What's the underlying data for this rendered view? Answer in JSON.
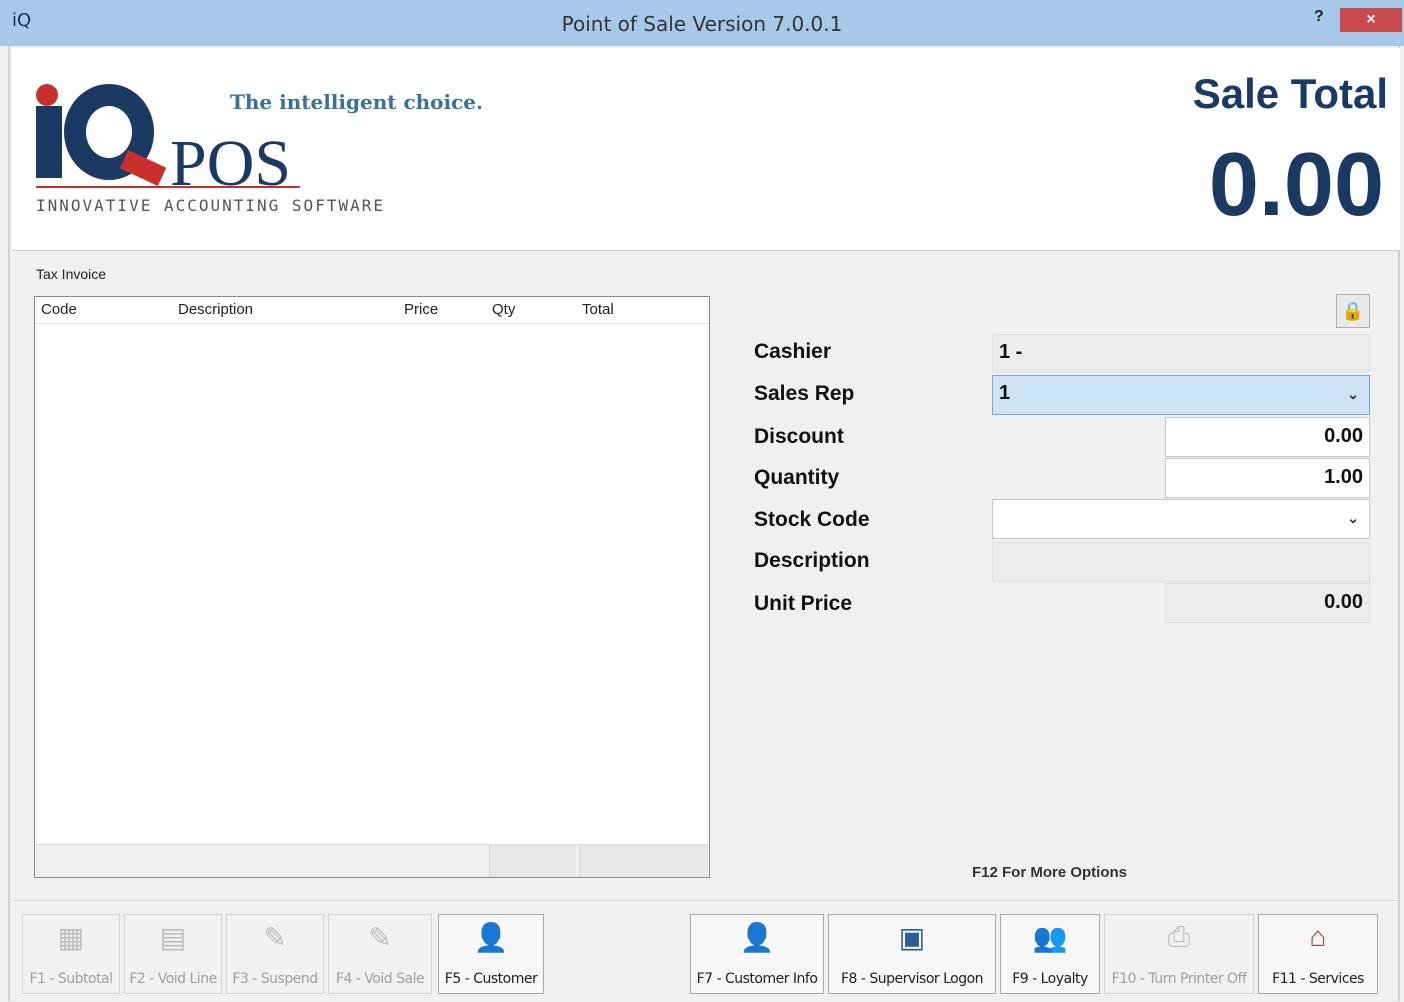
{
  "window": {
    "title": "Point of Sale Version 7.0.0.1",
    "app_icon": "iQ",
    "help": "?",
    "close": "×"
  },
  "logo": {
    "slogan": "The intelligent choice.",
    "pos": "POS",
    "tagline": "INNOVATIVE ACCOUNTING SOFTWARE"
  },
  "sale": {
    "title": "Sale Total",
    "value": "0.00"
  },
  "invoice": {
    "label": "Tax Invoice",
    "columns": [
      "Code",
      "Description",
      "Price",
      "Qty",
      "Total"
    ]
  },
  "form": {
    "cashier": {
      "label": "Cashier",
      "value": "1 -"
    },
    "sales_rep": {
      "label": "Sales Rep",
      "value": "1"
    },
    "discount": {
      "label": "Discount",
      "value": "0.00"
    },
    "quantity": {
      "label": "Quantity",
      "value": "1.00"
    },
    "stock_code": {
      "label": "Stock Code",
      "value": ""
    },
    "description": {
      "label": "Description",
      "value": ""
    },
    "unit_price": {
      "label": "Unit Price",
      "value": "0.00"
    }
  },
  "more_options": "F12 For More Options",
  "toolbar": [
    {
      "label": "F1 - Subtotal",
      "enabled": false,
      "icon": "calculator-icon"
    },
    {
      "label": "F2 - Void Line",
      "enabled": false,
      "icon": "void-line-icon"
    },
    {
      "label": "F3 - Suspend",
      "enabled": false,
      "icon": "suspend-icon"
    },
    {
      "label": "F4 - Void Sale",
      "enabled": false,
      "icon": "void-sale-icon"
    },
    {
      "label": "F5 - Customer",
      "enabled": true,
      "icon": "customer-icon"
    },
    {
      "label": "F7 - Customer Info",
      "enabled": true,
      "icon": "customer-info-icon"
    },
    {
      "label": "F8 - Supervisor Logon",
      "enabled": true,
      "icon": "supervisor-icon"
    },
    {
      "label": "F9 - Loyalty",
      "enabled": true,
      "icon": "loyalty-icon"
    },
    {
      "label": "F10 - Turn Printer Off",
      "enabled": false,
      "icon": "printer-icon"
    },
    {
      "label": "F11 - Services",
      "enabled": true,
      "icon": "services-icon"
    }
  ]
}
